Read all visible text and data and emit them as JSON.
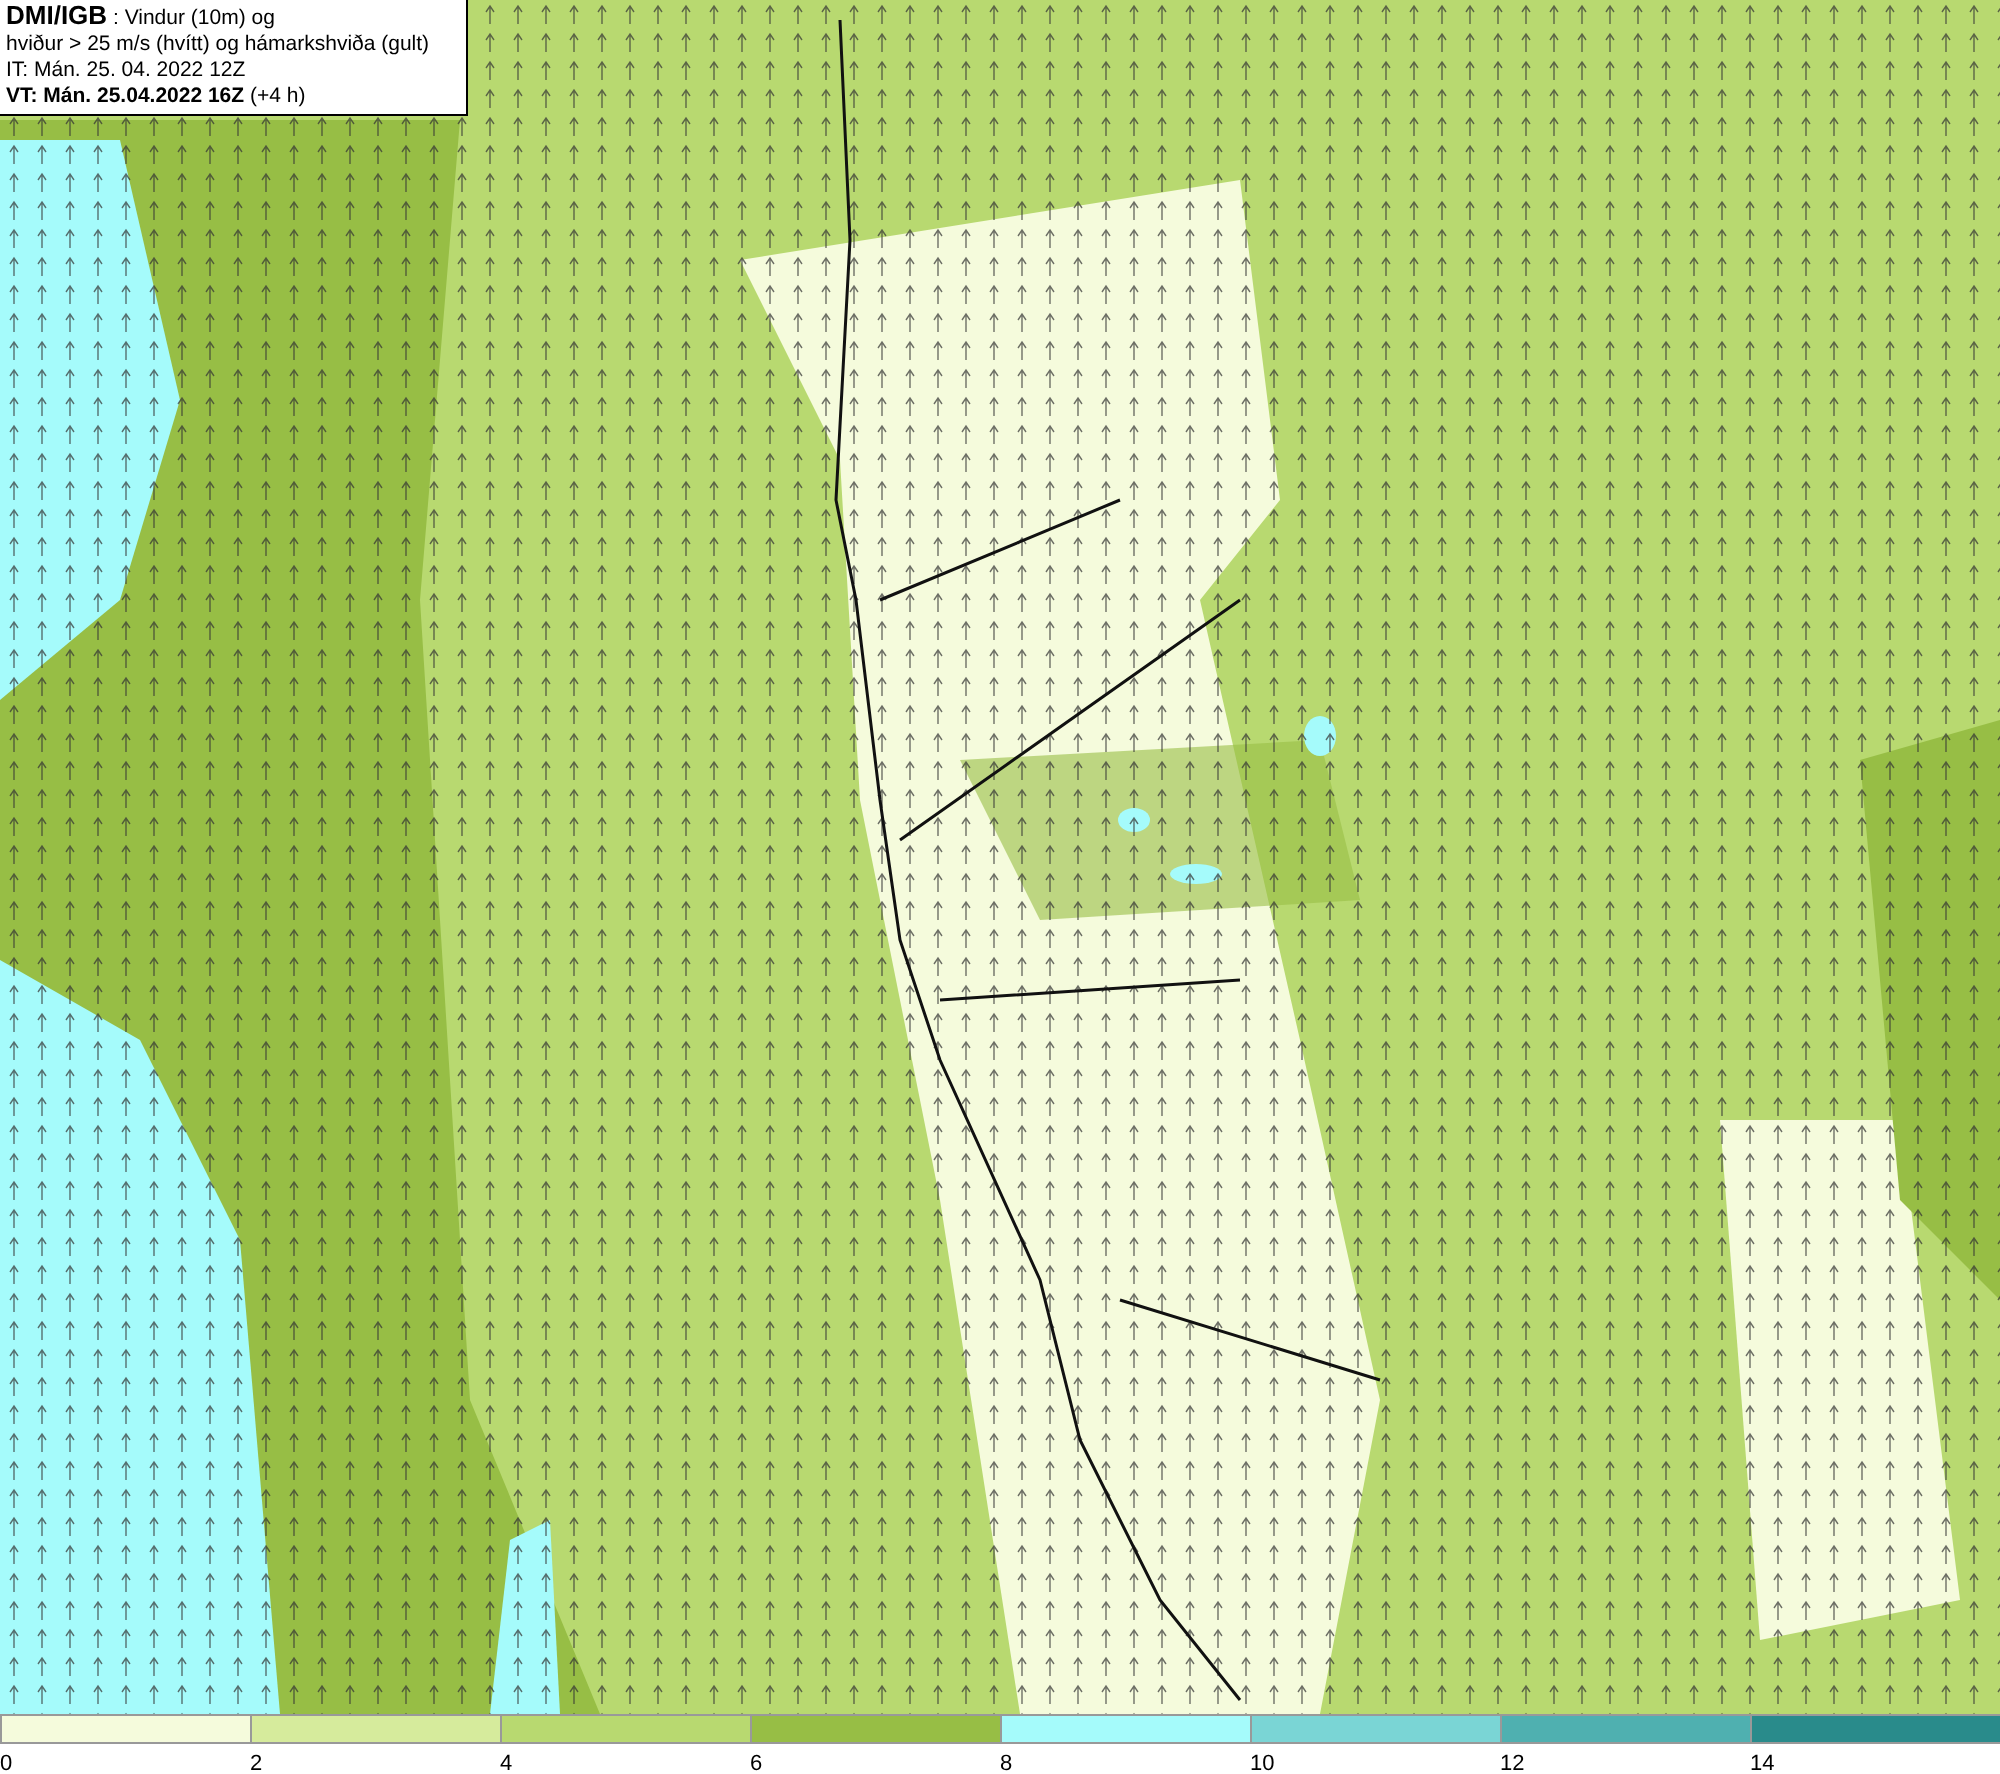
{
  "header": {
    "lines": [
      "**DMI/IGB** : Vindur (10m) og",
      "hviður > 25 m/s (hvítt) og hámarkshviða (gult)",
      "IT: Mán. 25. 04. 2022 12Z",
      "**VT: Mán. 25.04.2022 16Z** (+4 h)"
    ]
  },
  "legend": {
    "bins": [
      {
        "color": "#f5fbdc",
        "label": "0"
      },
      {
        "color": "#d6eb9c",
        "label": "2"
      },
      {
        "color": "#b8d970",
        "label": "4"
      },
      {
        "color": "#97be45",
        "label": "6"
      },
      {
        "color": "#a5fbfb",
        "label": "8"
      },
      {
        "color": "#7ad5d5",
        "label": "10"
      },
      {
        "color": "#4fb0b0",
        "label": "12"
      },
      {
        "color": "#298b8b",
        "label": "14"
      }
    ]
  }
}
